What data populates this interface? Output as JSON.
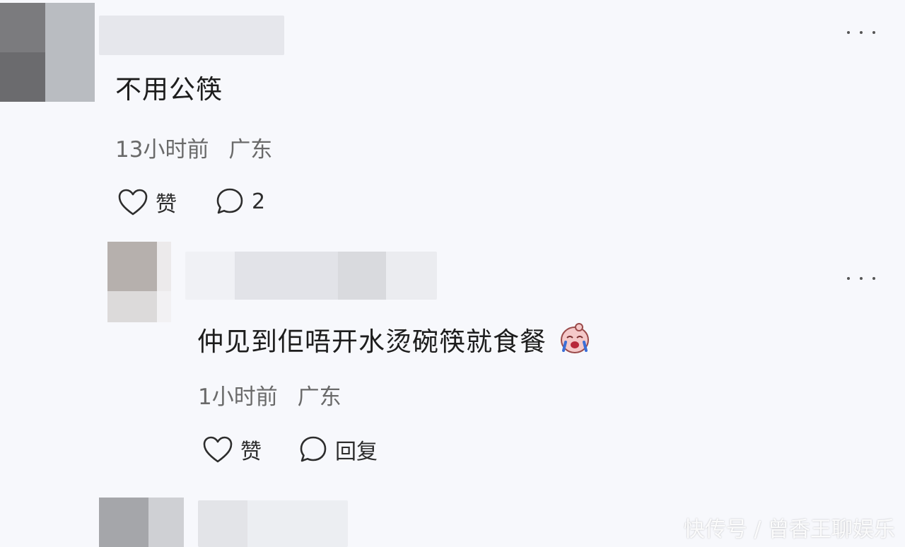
{
  "comments": [
    {
      "content": "不用公筷",
      "time": "13小时前",
      "location": "广东",
      "like_label": "赞",
      "reply_label": "2"
    },
    {
      "content": "仲见到佢唔开水烫碗筷就食餐",
      "time": "1小时前",
      "location": "广东",
      "like_label": "赞",
      "reply_label": "回复"
    }
  ],
  "watermark": "快传号 / 曾香王聊娱乐",
  "icons": {
    "more": "more-dots-icon",
    "like": "heart-icon",
    "reply": "speech-bubble-icon",
    "emoji": "crying-emoji-icon"
  }
}
